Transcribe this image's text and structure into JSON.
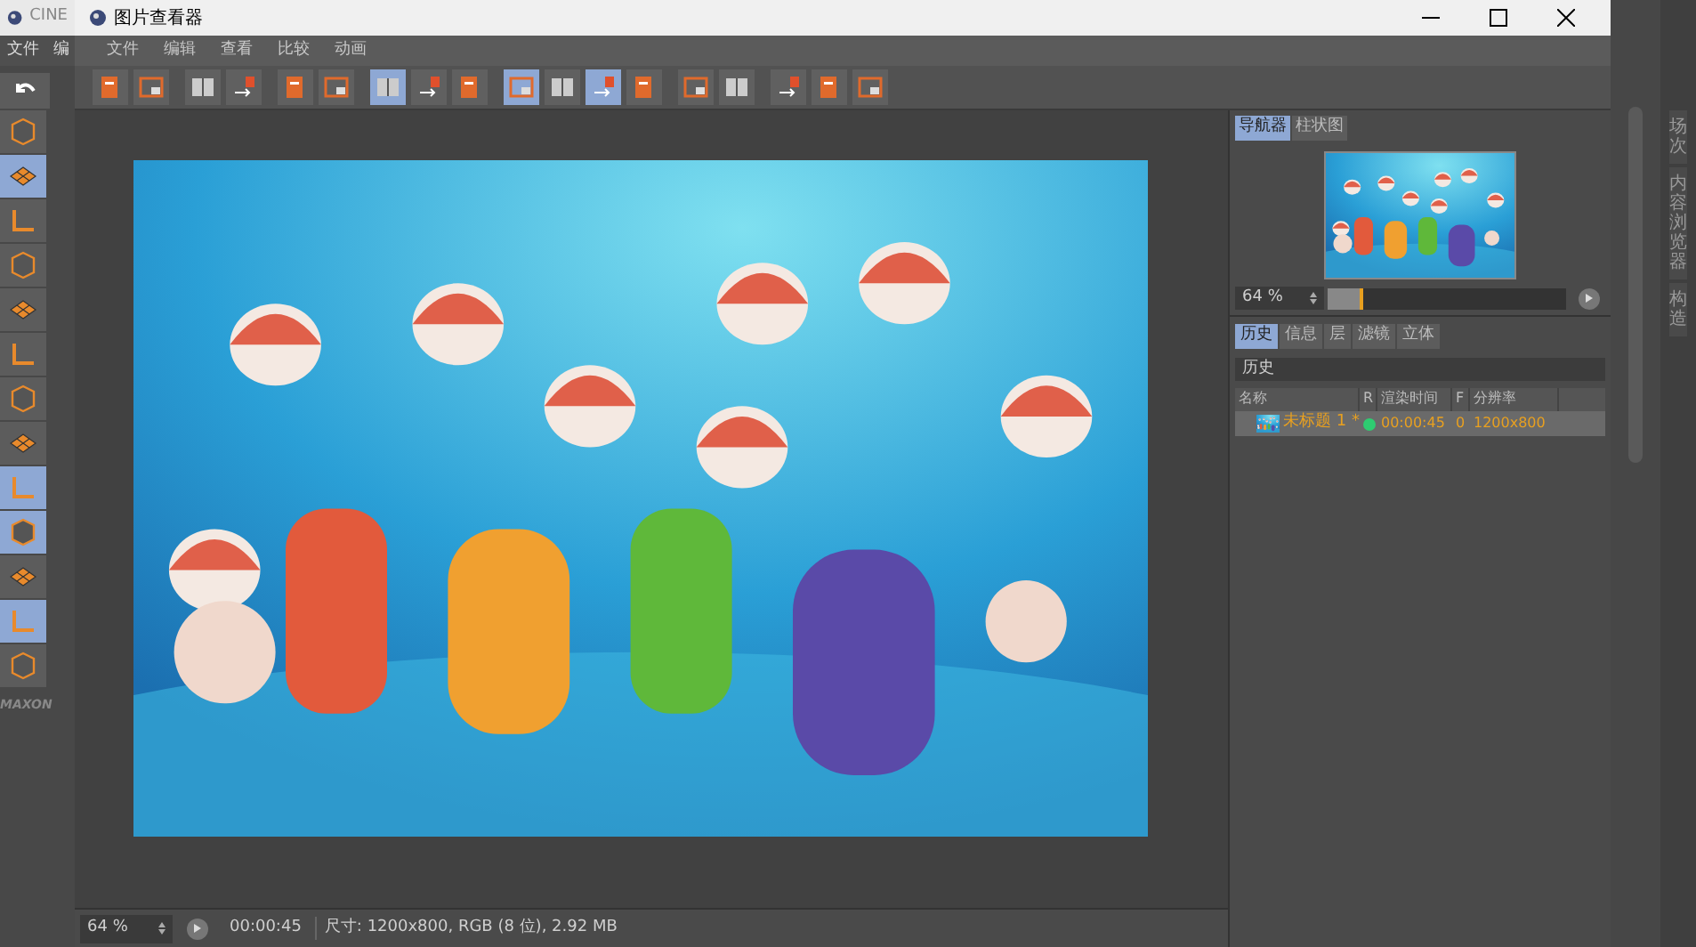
{
  "background_app": {
    "title": "CINE",
    "menu": [
      "文件",
      "编"
    ],
    "tools": [
      {
        "selected": false
      },
      {
        "selected": true
      },
      {
        "selected": false
      },
      {
        "selected": false
      },
      {
        "selected": false
      },
      {
        "selected": false
      },
      {
        "selected": false
      },
      {
        "selected": false
      },
      {
        "selected": true
      },
      {
        "selected": true
      },
      {
        "selected": false
      },
      {
        "selected": true
      },
      {
        "selected": false
      }
    ],
    "side_tabs": [
      "场次",
      "内容浏览器",
      "构造"
    ],
    "brand": "MAXON"
  },
  "window": {
    "title": "图片查看器"
  },
  "menu": [
    "文件",
    "编辑",
    "查看",
    "比较",
    "动画"
  ],
  "toolbar": [
    {
      "selected": false
    },
    {
      "selected": false
    },
    {
      "selected": false
    },
    {
      "selected": false
    },
    {
      "selected": false
    },
    {
      "selected": false
    },
    {
      "selected": true
    },
    {
      "selected": false
    },
    {
      "selected": false
    },
    {
      "selected": true
    },
    {
      "selected": false
    },
    {
      "selected": true
    },
    {
      "selected": false
    },
    {
      "selected": false
    },
    {
      "selected": false
    },
    {
      "selected": false
    },
    {
      "selected": false
    },
    {
      "selected": false
    }
  ],
  "navigator": {
    "tabs": [
      {
        "label": "导航器",
        "selected": true
      },
      {
        "label": "柱状图",
        "selected": false
      }
    ],
    "zoom": "64 %",
    "level": 0.15
  },
  "history": {
    "tabs": [
      {
        "label": "历史",
        "selected": true
      },
      {
        "label": "信息",
        "selected": false
      },
      {
        "label": "层",
        "selected": false
      },
      {
        "label": "滤镜",
        "selected": false
      },
      {
        "label": "立体",
        "selected": false
      }
    ],
    "title": "历史",
    "columns": [
      "名称",
      "R",
      "渲染时间",
      "F",
      "分辨率"
    ],
    "rows": [
      {
        "name": "未标题 1 *",
        "time": "00:00:45",
        "frame": "0",
        "resolution": "1200x800",
        "selected": true
      }
    ]
  },
  "status_bar": {
    "zoom": "64 %",
    "time": "00:00:45",
    "info": "尺寸: 1200x800, RGB (8 位), 2.92 MB"
  }
}
